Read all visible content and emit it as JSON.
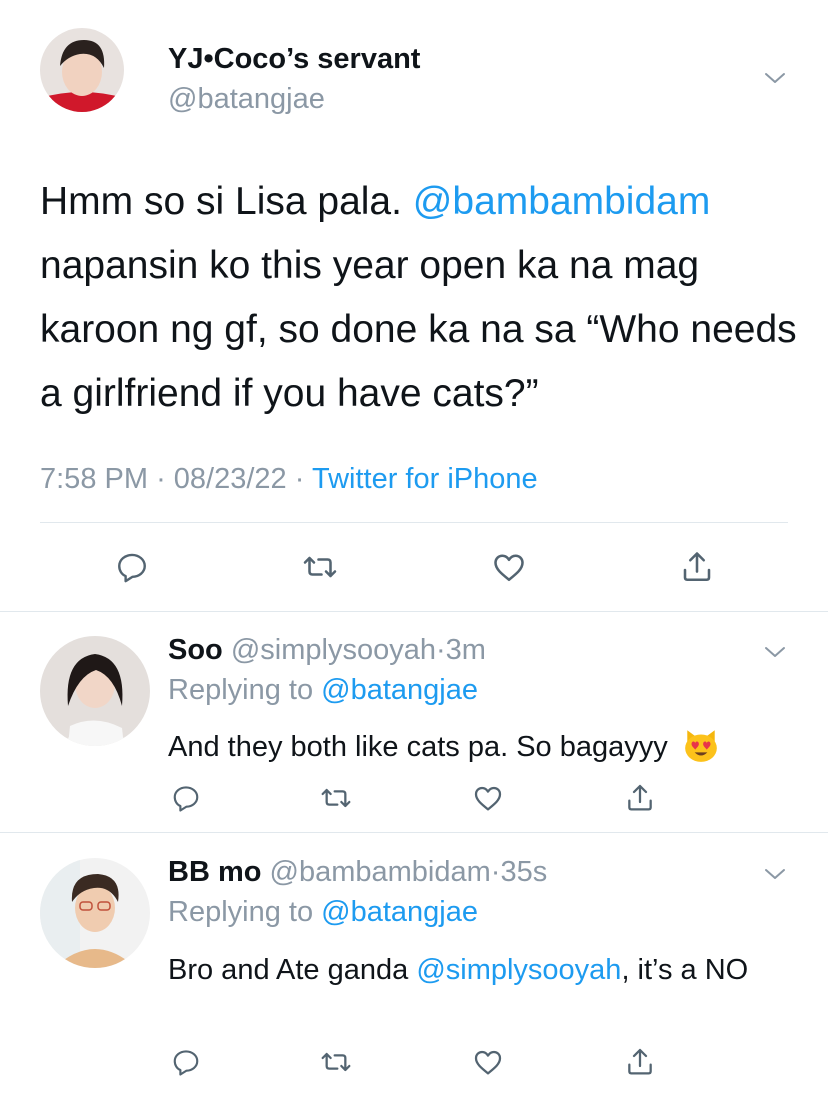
{
  "main_tweet": {
    "display_name": "YJ•Coco’s servant",
    "handle": "@batangjae",
    "text_before": "Hmm so si Lisa pala. ",
    "mention": "@bambambidam",
    "text_after": " napansin ko this year open ka na mag karoon ng gf, so done ka na sa “Who needs a girlfriend if you have cats?”",
    "time": "7:58 PM",
    "date": "08/23/22",
    "source": "Twitter for iPhone",
    "sep1": "·",
    "sep2": "·"
  },
  "replies": [
    {
      "display_name": "Soo",
      "handle": "@simplysooyah",
      "age": "3m",
      "sep": "·",
      "replying_prefix": "Replying to ",
      "replying_handle": "@batangjae",
      "text": "And they both like cats pa. So bagayyy",
      "emoji": "smiling-cat-heart-eyes"
    },
    {
      "display_name": "BB mo",
      "handle": "@bambambidam",
      "age": "35s",
      "sep": "·",
      "replying_prefix": "Replying to ",
      "replying_handle": "@batangjae",
      "text_before": "Bro and Ate ganda ",
      "mention": "@simplysooyah",
      "text_after": ", it’s a NO"
    }
  ],
  "colors": {
    "link": "#1d9bf0",
    "secondary_text": "#8b98a5",
    "icon": "#536471",
    "divider": "#e1e8ed"
  },
  "icons": [
    "chevron-down-icon",
    "reply-icon",
    "retweet-icon",
    "like-icon",
    "share-icon"
  ]
}
